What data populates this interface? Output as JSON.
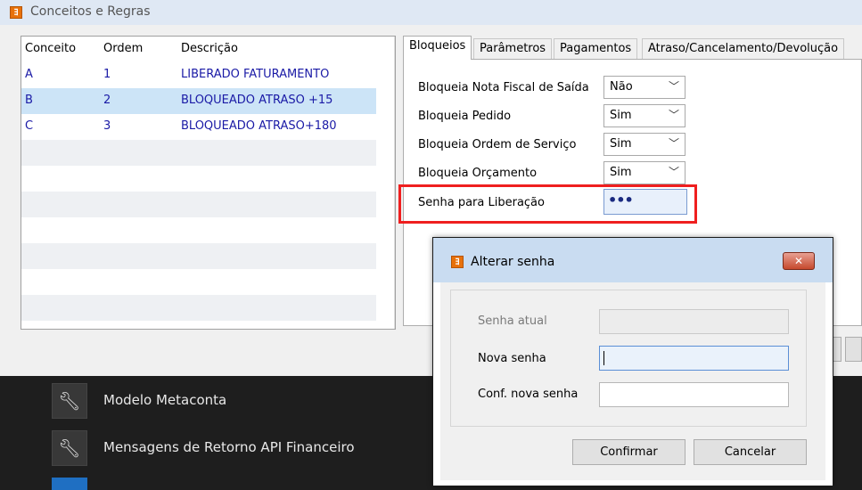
{
  "window": {
    "title": "Conceitos e Regras",
    "icon": "app-logo-icon"
  },
  "grid": {
    "columns": [
      "Conceito",
      "Ordem",
      "Descrição"
    ],
    "rows": [
      {
        "conceito": "A",
        "ordem": "1",
        "descricao": "LIBERADO FATURAMENTO"
      },
      {
        "conceito": "B",
        "ordem": "2",
        "descricao": "BLOQUEADO ATRASO +15"
      },
      {
        "conceito": "C",
        "ordem": "3",
        "descricao": "BLOQUEADO ATRASO+180"
      }
    ],
    "selected_row": 1
  },
  "tabs": [
    "Bloqueios",
    "Parâmetros",
    "Pagamentos",
    "Atraso/Cancelamento/Devolução"
  ],
  "active_tab": "Bloqueios",
  "bloqueios": {
    "nota_fiscal": {
      "label": "Bloqueia Nota Fiscal de Saída",
      "value": "Não"
    },
    "pedido": {
      "label": "Bloqueia Pedido",
      "value": "Sim"
    },
    "ordem_servico": {
      "label": "Bloqueia Ordem de Serviço",
      "value": "Sim"
    },
    "orcamento": {
      "label": "Bloqueia Orçamento",
      "value": "Sim"
    },
    "senha": {
      "label": "Senha para Liberação",
      "value": "•••"
    }
  },
  "menu": [
    {
      "label": "Modelo Metaconta",
      "icon": "wrench-icon"
    },
    {
      "label": "Mensagens de Retorno API Financeiro",
      "icon": "wrench-icon"
    }
  ],
  "dialog": {
    "title": "Alterar senha",
    "fields": {
      "senha_atual": "Senha atual",
      "nova_senha": "Nova senha",
      "conf_nova_senha": "Conf. nova senha"
    },
    "confirm": "Confirmar",
    "cancel": "Cancelar"
  },
  "colors": {
    "grid_text": "#1a1aa6",
    "selection": "#cce4f7",
    "highlight": "#ef1f1f"
  }
}
